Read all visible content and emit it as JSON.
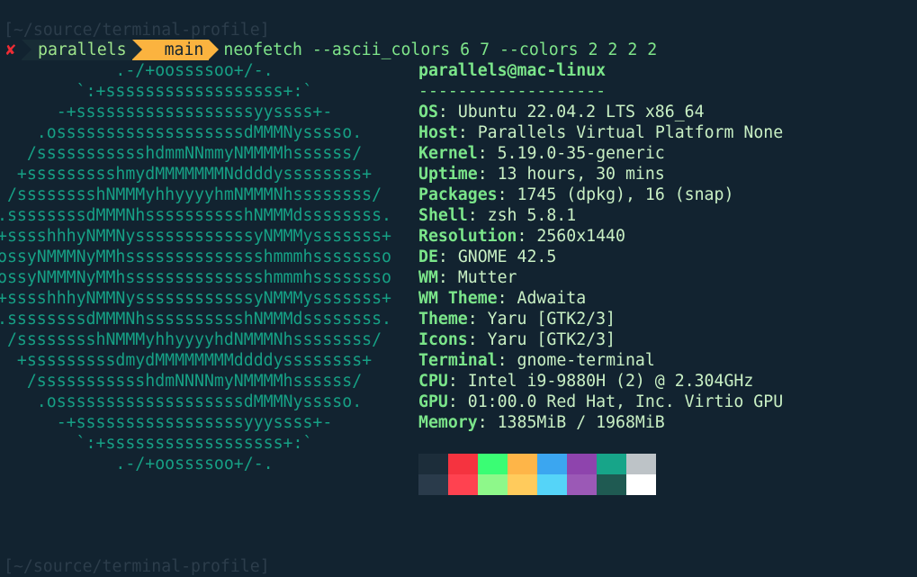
{
  "cwd": "[~/source/terminal-profile]",
  "prompt": {
    "status_icon": "✘",
    "user": "parallels",
    "git_icon": "branch-icon",
    "branch": "main",
    "command": "neofetch --ascii_colors 6 7 --colors 2 2 2 2"
  },
  "ascii_art": [
    "            .-/+oossssoo+/-.",
    "        `:+ssssssssssssssssss+:`",
    "      -+ssssssssssssssssssyyssss+-",
    "    .osssssssssssssssssssdMMMNysssso.",
    "   /ssssssssssshdmmNNmmyNMMMMhssssss/",
    "  +ssssssssshmydMMMMMMMNddddyssssssss+",
    " /sssssssshNMMMyhhyyyyhmNMMMNhssssssss/",
    ".ssssssssdMMMNhsssssssssshNMMMdssssssss.",
    "+sssshhhyNMMNyssssssssssssyNMMMysssssss+",
    "ossyNMMMNyMMhsssssssssssssshmmmhssssssso",
    "ossyNMMMNyMMhsssssssssssssshmmmhssssssso",
    "+sssshhhyNMMNyssssssssssssyNMMMysssssss+",
    ".ssssssssdMMMNhsssssssssshNMMMdssssssss.",
    " /sssssssshNMMMyhhyyyyhdNMMMNhssssssss/",
    "  +sssssssssdmydMMMMMMMMddddyssssssss+",
    "   /ssssssssssshdmNNNNmyNMMMMhssssss/",
    "    .osssssssssssssssssssdMMMNysssso.",
    "      -+sssssssssssssssssyyyssss+-",
    "        `:+ssssssssssssssssss+:`",
    "            .-/+oossssoo+/-."
  ],
  "info": {
    "title": "parallels@mac-linux",
    "separator": "-------------------",
    "rows": [
      {
        "key": "OS",
        "value": "Ubuntu 22.04.2 LTS x86_64"
      },
      {
        "key": "Host",
        "value": "Parallels Virtual Platform None"
      },
      {
        "key": "Kernel",
        "value": "5.19.0-35-generic"
      },
      {
        "key": "Uptime",
        "value": "13 hours, 30 mins"
      },
      {
        "key": "Packages",
        "value": "1745 (dpkg), 16 (snap)"
      },
      {
        "key": "Shell",
        "value": "zsh 5.8.1"
      },
      {
        "key": "Resolution",
        "value": "2560x1440"
      },
      {
        "key": "DE",
        "value": "GNOME 42.5"
      },
      {
        "key": "WM",
        "value": "Mutter"
      },
      {
        "key": "WM Theme",
        "value": "Adwaita"
      },
      {
        "key": "Theme",
        "value": "Yaru [GTK2/3]"
      },
      {
        "key": "Icons",
        "value": "Yaru [GTK2/3]"
      },
      {
        "key": "Terminal",
        "value": "gnome-terminal"
      },
      {
        "key": "CPU",
        "value": "Intel i9-9880H (2) @ 2.304GHz"
      },
      {
        "key": "GPU",
        "value": "01:00.0 Red Hat, Inc. Virtio GPU"
      },
      {
        "key": "Memory",
        "value": "1385MiB / 1968MiB"
      }
    ]
  },
  "palette": {
    "normal": [
      "#1c2d3a",
      "#f5333f",
      "#3afd74",
      "#feb548",
      "#3ba6f0",
      "#8e44ad",
      "#17a589",
      "#bdc3c7"
    ],
    "bright": [
      "#2a3b4b",
      "#ff4250",
      "#8ef88a",
      "#ffcb5c",
      "#55d4f8",
      "#9b59b6",
      "#1f5a52",
      "#ffffff"
    ]
  },
  "bottom_cwd": "[~/source/terminal-profile]"
}
